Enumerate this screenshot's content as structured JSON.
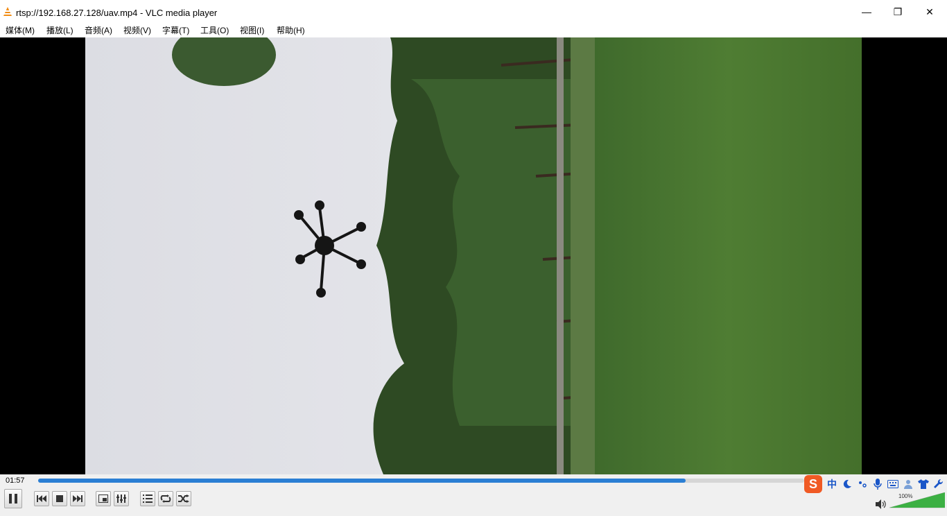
{
  "window": {
    "title": "rtsp://192.168.27.128/uav.mp4 - VLC media player",
    "minimize_glyph": "—",
    "restore_glyph": "❐",
    "close_glyph": "✕"
  },
  "menu": [
    {
      "label": "媒体(M)",
      "name": "menu-media"
    },
    {
      "label": "播放(L)",
      "name": "menu-playback"
    },
    {
      "label": "音频(A)",
      "name": "menu-audio"
    },
    {
      "label": "视频(V)",
      "name": "menu-video"
    },
    {
      "label": "字幕(T)",
      "name": "menu-subtitle"
    },
    {
      "label": "工具(O)",
      "name": "menu-tools"
    },
    {
      "label": "视图(I)",
      "name": "menu-view"
    },
    {
      "label": "帮助(H)",
      "name": "menu-help"
    }
  ],
  "player": {
    "elapsed": "01:57",
    "progress": 0.845,
    "volume_label": "100%",
    "volume": 1.0
  },
  "controls": [
    {
      "name": "pause-button",
      "icon": "pause-icon"
    },
    {
      "name": "previous-button",
      "icon": "previous-icon"
    },
    {
      "name": "stop-button",
      "icon": "stop-icon"
    },
    {
      "name": "next-button",
      "icon": "next-icon"
    },
    {
      "name": "fullscreen-button",
      "icon": "fullscreen-icon"
    },
    {
      "name": "extended-settings-button",
      "icon": "equalizer-icon"
    },
    {
      "name": "playlist-button",
      "icon": "playlist-icon"
    },
    {
      "name": "loop-button",
      "icon": "loop-icon"
    },
    {
      "name": "shuffle-button",
      "icon": "shuffle-icon"
    }
  ],
  "ime_tray": {
    "logo": "S",
    "chinese": "中",
    "icons": [
      "sogou-logo-icon",
      "chinese-mode-icon",
      "moon-icon",
      "punctuation-icon",
      "microphone-icon",
      "keyboard-icon",
      "user-icon",
      "skin-shirt-icon",
      "wrench-icon"
    ]
  },
  "colors": {
    "accent": "#2b7fd4",
    "volume": "#3cb043",
    "sogou": "#f05a24"
  }
}
